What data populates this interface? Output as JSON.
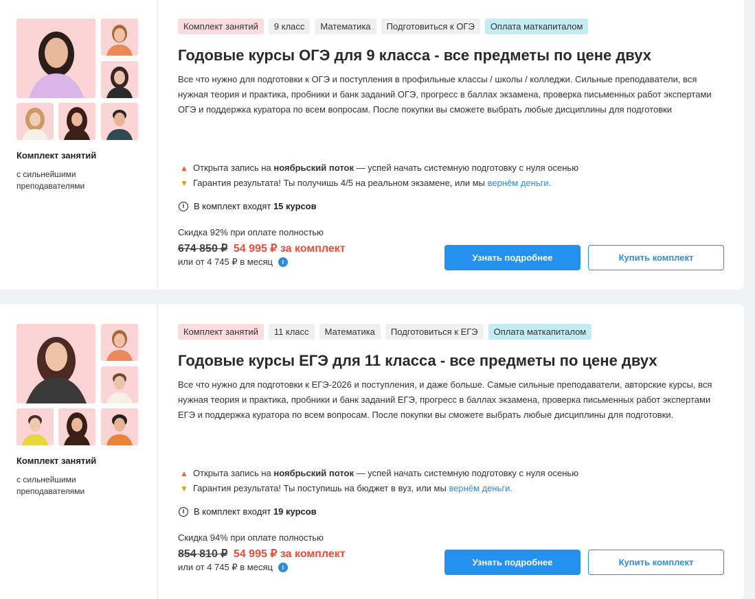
{
  "cards": [
    {
      "tags": [
        "Комплект занятий",
        "9 класс",
        "Математика",
        "Подготовиться к ОГЭ",
        "Оплата маткапиталом"
      ],
      "title": "Годовые курсы ОГЭ для 9 класса - все предметы по цене двух",
      "description": "Все что нужно для подготовки к ОГЭ и поступления в профильные классы / школы / колледжи. Сильные преподаватели, вся нужная теория и практика, пробники и банк заданий ОГЭ, прогресс в баллах экзамена, проверка письменных работ экспертами ОГЭ и поддержка куратора по всем вопросам. После покупки вы сможете выбрать любые дисциплины для подготовки",
      "aside_title": "Комплект занятий",
      "aside_sub": "с сильнейшими преподавателями",
      "promo1_pre": "Открыта запись на ",
      "promo1_bold": "ноябрьский поток",
      "promo1_post": " — успей начать системную подготовку с нуля осенью",
      "promo2_pre": "Гарантия результата! Ты получишь 4/5 на реальном экзамене, или мы ",
      "promo2_link": "вернём деньги.",
      "includes_pre": "В комплект входят ",
      "includes_bold": "15 курсов",
      "discount": "Скидка 92% при оплате полностью",
      "old_price": "674 850 ₽",
      "new_price": "54 995 ₽ за комплект",
      "monthly": "или от 4 745 ₽ в месяц",
      "btn_more": "Узнать подробнее",
      "btn_buy": "Купить комплект"
    },
    {
      "tags": [
        "Комплект занятий",
        "11 класс",
        "Математика",
        "Подготовиться к ЕГЭ",
        "Оплата маткапиталом"
      ],
      "title": "Годовые курсы ЕГЭ для 11 класса - все предметы по цене двух",
      "description": "Все что нужно для подготовки к ЕГЭ-2026 и поступления, и даже больше. Самые сильные преподаватели, авторские курсы, вся нужная теория и практика, пробники и банк заданий ЕГЭ, прогресс в баллах экзамена, проверка письменных работ экспертами ЕГЭ и поддержка куратора по всем вопросам. После покупки вы сможете выбрать любые дисциплины для подготовки.",
      "aside_title": "Комплект занятий",
      "aside_sub": "с сильнейшими преподавателями",
      "promo1_pre": "Открыта запись на ",
      "promo1_bold": "ноябрьский поток",
      "promo1_post": " — успей начать системную подготовку с нуля осенью",
      "promo2_pre": "Гарантия результата! Ты поступишь на бюджет в вуз, или мы ",
      "promo2_link": "вернём деньги.",
      "includes_pre": "В комплект входят ",
      "includes_bold": "19 курсов",
      "discount": "Скидка 94% при оплате полностью",
      "old_price": "854 810 ₽",
      "new_price": "54 995 ₽ за комплект",
      "monthly": "или от 4 745 ₽ в месяц",
      "btn_more": "Узнать подробнее",
      "btn_buy": "Купить комплект"
    }
  ],
  "icons": {
    "fire": "fire-icon",
    "trophy": "trophy-icon",
    "info": "info-icon"
  },
  "colors": {
    "accent": "#2591ee",
    "price_new": "#ef4b36",
    "tag_pink": "#fcdcdc",
    "tag_cyan": "#c3edf2",
    "photo_bg": "#fbd4d6"
  }
}
